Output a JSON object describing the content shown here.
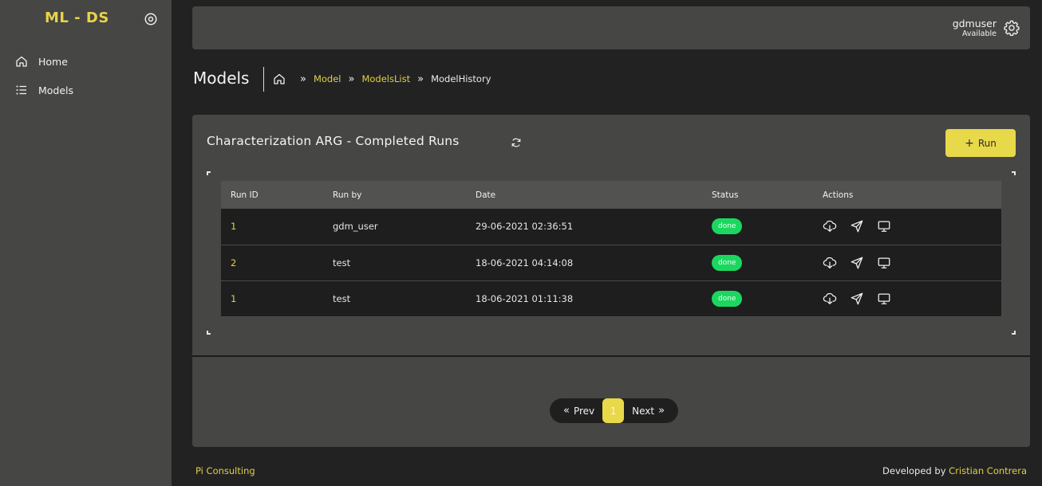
{
  "app": {
    "brand": "ML - DS"
  },
  "sidebar": {
    "items": [
      {
        "label": "Home",
        "icon": "home-icon"
      },
      {
        "label": "Models",
        "icon": "list-icon"
      }
    ]
  },
  "topbar": {
    "username": "gdmuser",
    "status": "Available"
  },
  "page": {
    "title": "Models",
    "breadcrumb": [
      {
        "label": "Model"
      },
      {
        "label": "ModelsList"
      },
      {
        "label": "ModelHistory"
      }
    ]
  },
  "card": {
    "title": "Characterization ARG - Completed Runs",
    "run_button": "Run"
  },
  "table": {
    "columns": [
      "Run ID",
      "Run by",
      "Date",
      "Status",
      "Actions"
    ],
    "rows": [
      {
        "run_id": "1",
        "run_by": "gdm_user",
        "date": "29-06-2021 02:36:51",
        "status": "done"
      },
      {
        "run_id": "2",
        "run_by": "test",
        "date": "18-06-2021 04:14:08",
        "status": "done"
      },
      {
        "run_id": "1",
        "run_by": "test",
        "date": "18-06-2021 01:11:38",
        "status": "done"
      }
    ]
  },
  "pagination": {
    "prev": "Prev",
    "current": "1",
    "next": "Next"
  },
  "footer": {
    "left": "Pi Consulting",
    "right_prefix": "Developed by",
    "author": "Cristian Contrera"
  },
  "colors": {
    "accent": "#e8d94a",
    "status_done": "#1bd760",
    "sidebar": "#464644",
    "background": "#222222"
  }
}
